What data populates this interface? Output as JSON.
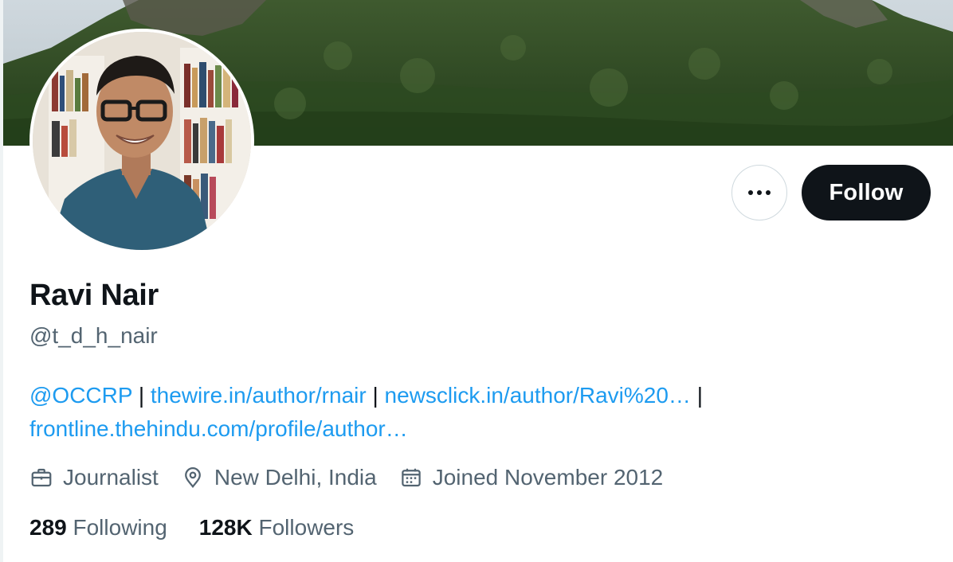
{
  "colors": {
    "link": "#1d9bf0",
    "text_primary": "#0f1419",
    "text_secondary": "#536471",
    "follow_bg": "#0f1419",
    "border": "#cfd9de"
  },
  "header": {
    "banner_icon": "mountain-forest-banner",
    "avatar_icon": "profile-photo"
  },
  "actions": {
    "more_icon": "more-horizontal-icon",
    "follow_label": "Follow"
  },
  "profile": {
    "display_name": "Ravi Nair",
    "handle": "@t_d_h_nair",
    "bio": {
      "link1": "@OCCRP",
      "sep1": " | ",
      "link2": "thewire.in/author/rnair",
      "sep2": " | ",
      "link3": "newsclick.in/author/Ravi%20…",
      "sep3": " | ",
      "link4": "frontline.thehindu.com/profile/author…"
    },
    "meta": {
      "profession": "Journalist",
      "profession_icon": "briefcase-icon",
      "location": "New Delhi, India",
      "location_icon": "location-pin-icon",
      "joined": "Joined November 2012",
      "joined_icon": "calendar-icon"
    },
    "stats": {
      "following_count": "289",
      "following_label": " Following",
      "followers_count": "128K",
      "followers_label": " Followers"
    }
  }
}
